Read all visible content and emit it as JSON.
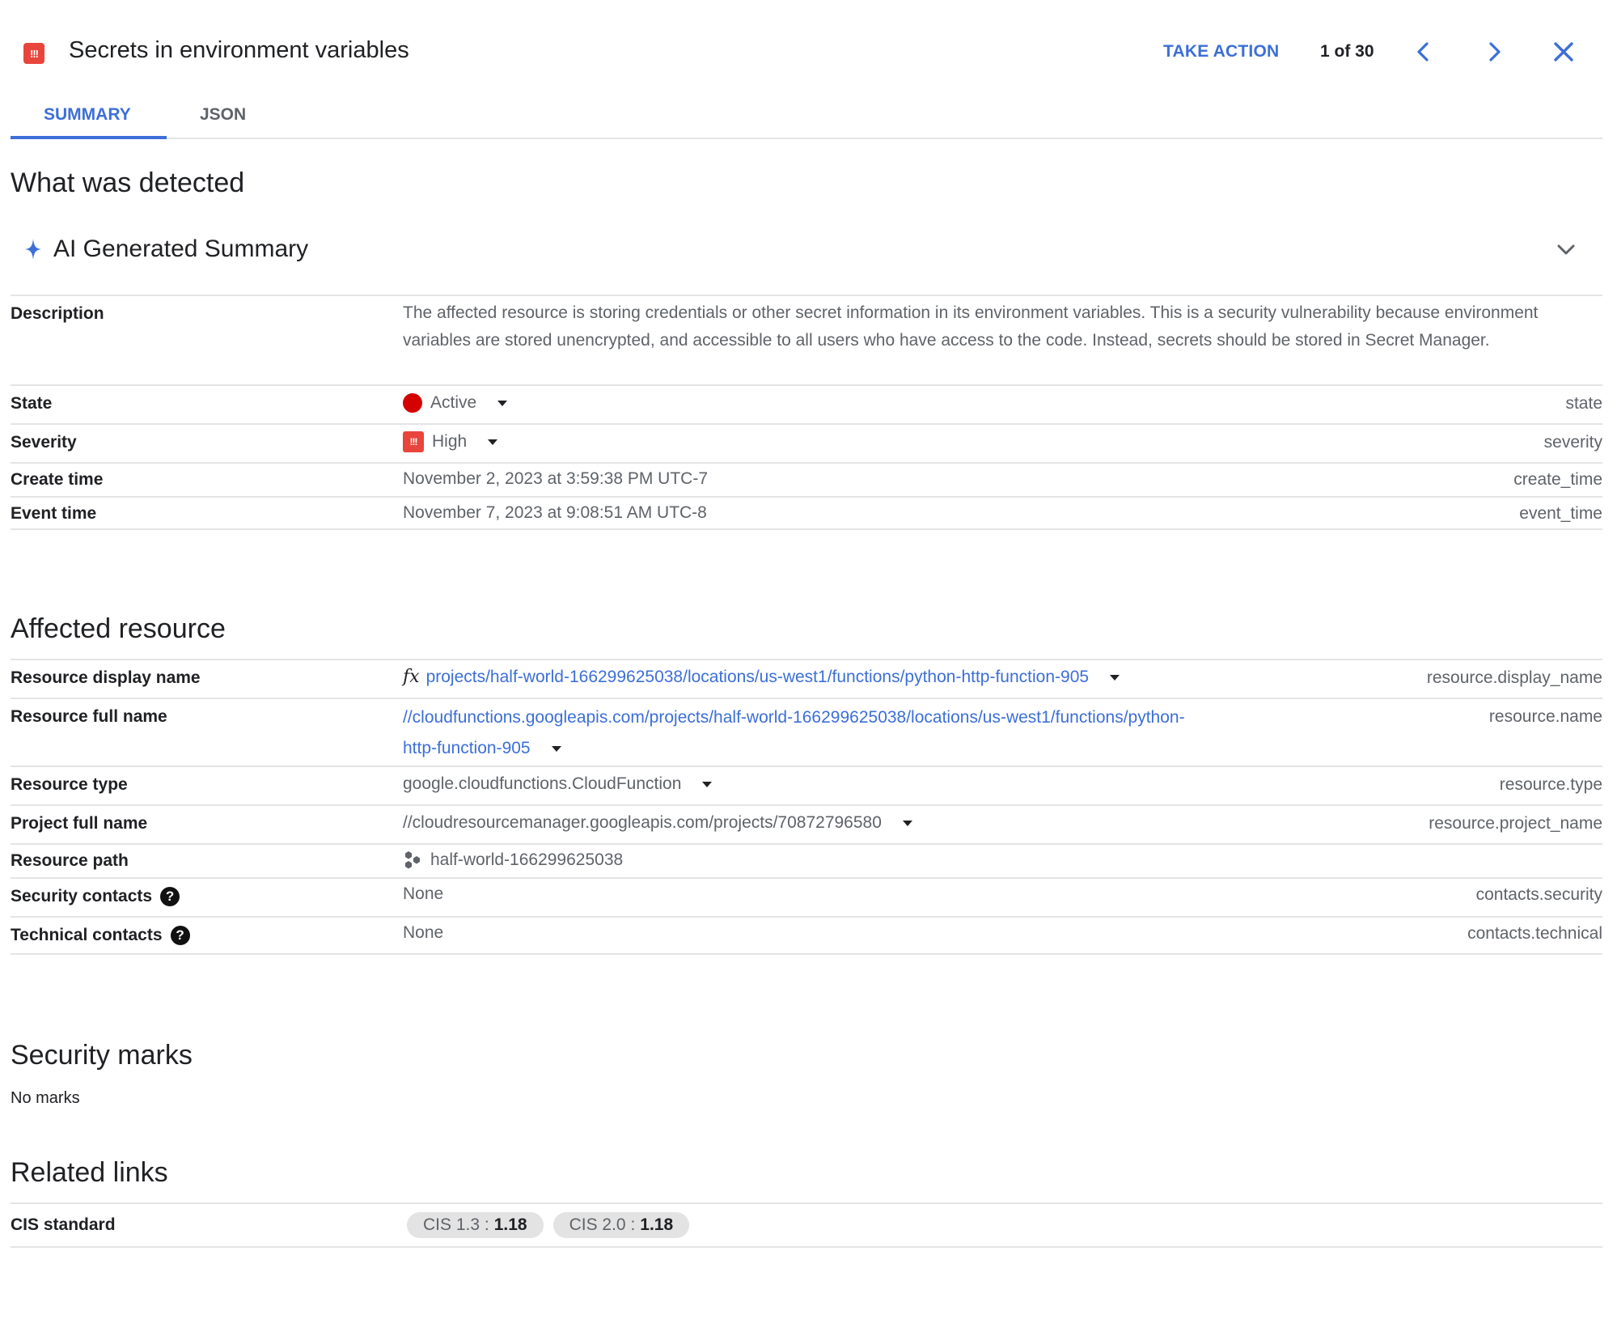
{
  "header": {
    "severity_icon": "severity-high-icon",
    "title": "Secrets in environment variables",
    "take_action": "TAKE ACTION",
    "pager": "1 of 30",
    "prev_icon": "chevron-left-icon",
    "next_icon": "chevron-right-icon",
    "close_icon": "close-icon"
  },
  "tabs": [
    {
      "label": "SUMMARY",
      "active": true
    },
    {
      "label": "JSON",
      "active": false
    }
  ],
  "detected": {
    "heading": "What was detected",
    "ai_summary": {
      "icon": "sparkle-icon",
      "label": "AI Generated Summary",
      "expanded": false
    },
    "rows": [
      {
        "label": "Description",
        "value": "The affected resource is storing credentials or other secret information in its environment variables. This is a security vulnerability because environment variables are stored unencrypted, and accessible to all users who have access to the code. Instead, secrets should be stored in Secret Manager.",
        "key": ""
      },
      {
        "label": "State",
        "value": "Active",
        "key": "state"
      },
      {
        "label": "Severity",
        "value": "High",
        "key": "severity"
      },
      {
        "label": "Create time",
        "value": "November 2, 2023 at 3:59:38 PM UTC-7",
        "key": "create_time"
      },
      {
        "label": "Event time",
        "value": "November 7, 2023 at 9:08:51 AM UTC-8",
        "key": "event_time"
      }
    ]
  },
  "affected": {
    "heading": "Affected resource",
    "rows": [
      {
        "label": "Resource display name",
        "value": "projects/half-world-166299625038/locations/us-west1/functions/python-http-function-905",
        "key": "resource.display_name"
      },
      {
        "label": "Resource full name",
        "value_line1": "//cloudfunctions.googleapis.com/projects/half-world-166299625038/locations/us-west1/functions/python-",
        "value_line2": "http-function-905",
        "key": "resource.name"
      },
      {
        "label": "Resource type",
        "value": "google.cloudfunctions.CloudFunction",
        "key": "resource.type"
      },
      {
        "label": "Project full name",
        "value": "//cloudresourcemanager.googleapis.com/projects/70872796580",
        "key": "resource.project_name"
      },
      {
        "label": "Resource path",
        "value": "half-world-166299625038",
        "key": ""
      },
      {
        "label": "Security contacts",
        "value": "None",
        "key": "contacts.security"
      },
      {
        "label": "Technical contacts",
        "value": "None",
        "key": "contacts.technical"
      }
    ]
  },
  "marks": {
    "heading": "Security marks",
    "text": "No marks"
  },
  "related": {
    "heading": "Related links",
    "rows": [
      {
        "label": "CIS standard",
        "chips": [
          {
            "name": "CIS 1.3 :",
            "value": "1.18"
          },
          {
            "name": "CIS 2.0 :",
            "value": "1.18"
          }
        ]
      }
    ]
  },
  "colors": {
    "accent": "#3c6fd8",
    "severity_high": "#e8453c",
    "state_active": "#d50000"
  }
}
